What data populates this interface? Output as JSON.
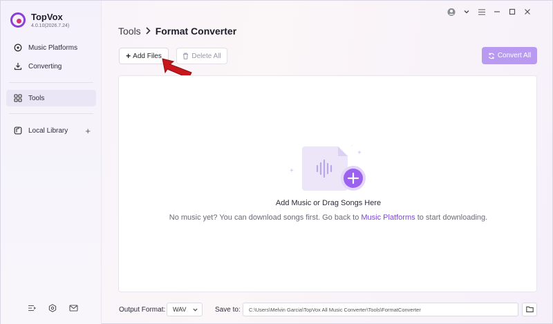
{
  "app": {
    "name": "TopVox",
    "version": "4.0.10(2026.7.24)"
  },
  "sidebar": {
    "items": [
      {
        "label": "Music Platforms",
        "icon": "music-platforms-icon"
      },
      {
        "label": "Converting",
        "icon": "download-icon"
      },
      {
        "label": "Tools",
        "icon": "grid-icon",
        "active": true
      },
      {
        "label": "Local Library",
        "icon": "library-icon"
      }
    ],
    "bottom_icons": [
      "list-icon",
      "settings-hex-icon",
      "mail-icon"
    ]
  },
  "window_controls": [
    "user-avatar-icon",
    "chevron-down-icon",
    "menu-icon",
    "minimize-icon",
    "maximize-icon",
    "close-icon"
  ],
  "breadcrumb": {
    "root": "Tools",
    "current": "Format Converter"
  },
  "toolbar": {
    "add_label": "Add Files",
    "delete_label": "Delete All",
    "convert_label": "Convert All"
  },
  "dropzone": {
    "title": "Add Music or Drag Songs Here",
    "sub_prefix": "No music yet? You can download songs first. Go back to",
    "sub_link": "Music Platforms",
    "sub_suffix": "to start downloading."
  },
  "bottom": {
    "format_label": "Output Format:",
    "format_value": "WAV",
    "save_label": "Save to:",
    "save_path": "C:\\Users\\Melvin Garcia\\TopVox All Music Converter\\Tools\\FormatConverter"
  },
  "colors": {
    "accent": "#7b48d6",
    "convert_bg": "#b89af0",
    "arrow": "#c8161d"
  }
}
